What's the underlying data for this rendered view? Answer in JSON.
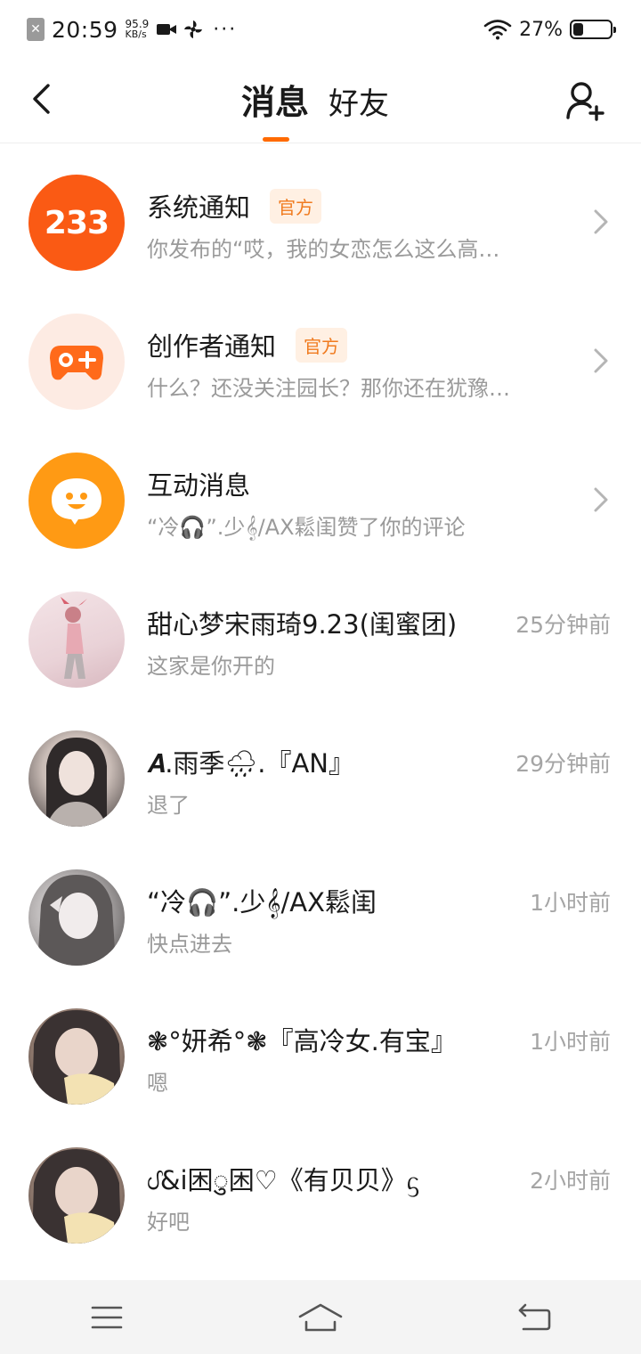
{
  "status_bar": {
    "time": "20:59",
    "speed_value": "95.9",
    "speed_unit": "KB/s",
    "dots": "···",
    "battery_percent": "27%",
    "battery_level": 0.27
  },
  "header": {
    "tab_messages": "消息",
    "tab_friends": "好友",
    "active_tab": "消息",
    "accent_color": "#ff6a00"
  },
  "rows": [
    {
      "title": "系统通知",
      "badge": "官方",
      "subtitle": "你发布的“哎，我的女恋怎么这么高…",
      "avatar_text": "233",
      "avatar_icon": "app-logo-233"
    },
    {
      "title": "创作者通知",
      "badge": "官方",
      "subtitle": "什么？还没关注园长？那你还在犹豫…",
      "avatar_icon": "gamepad-icon"
    },
    {
      "title": "互动消息",
      "subtitle": "“冷🎧”.少𝄞/AX鬆闺赞了你的评论",
      "avatar_icon": "chat-bubble-icon"
    },
    {
      "title": "甜心梦宋雨琦9.23(闺蜜团)",
      "subtitle": "这家是你开的",
      "time": "25分钟前"
    },
    {
      "title": "𝑨.雨季🌧.『AN』",
      "subtitle": "退了",
      "time": "29分钟前"
    },
    {
      "title": "“冷🎧”.少𝄞/AX鬆闺",
      "subtitle": "快点进去",
      "time": "1小时前"
    },
    {
      "title": "❃°妍希°❃『高冷女.有宝』",
      "subtitle": "嗯",
      "time": "1小时前"
    },
    {
      "title": "ᦔ&i困ु困♡《有贝贝》ᦓ",
      "subtitle": "好吧",
      "time": "2小时前"
    }
  ],
  "colors": {
    "badge_bg": "#fff0e3",
    "badge_text": "#f07a1e",
    "logo_orange": "#fa5a14",
    "interact_orange": "#ff9a14"
  }
}
